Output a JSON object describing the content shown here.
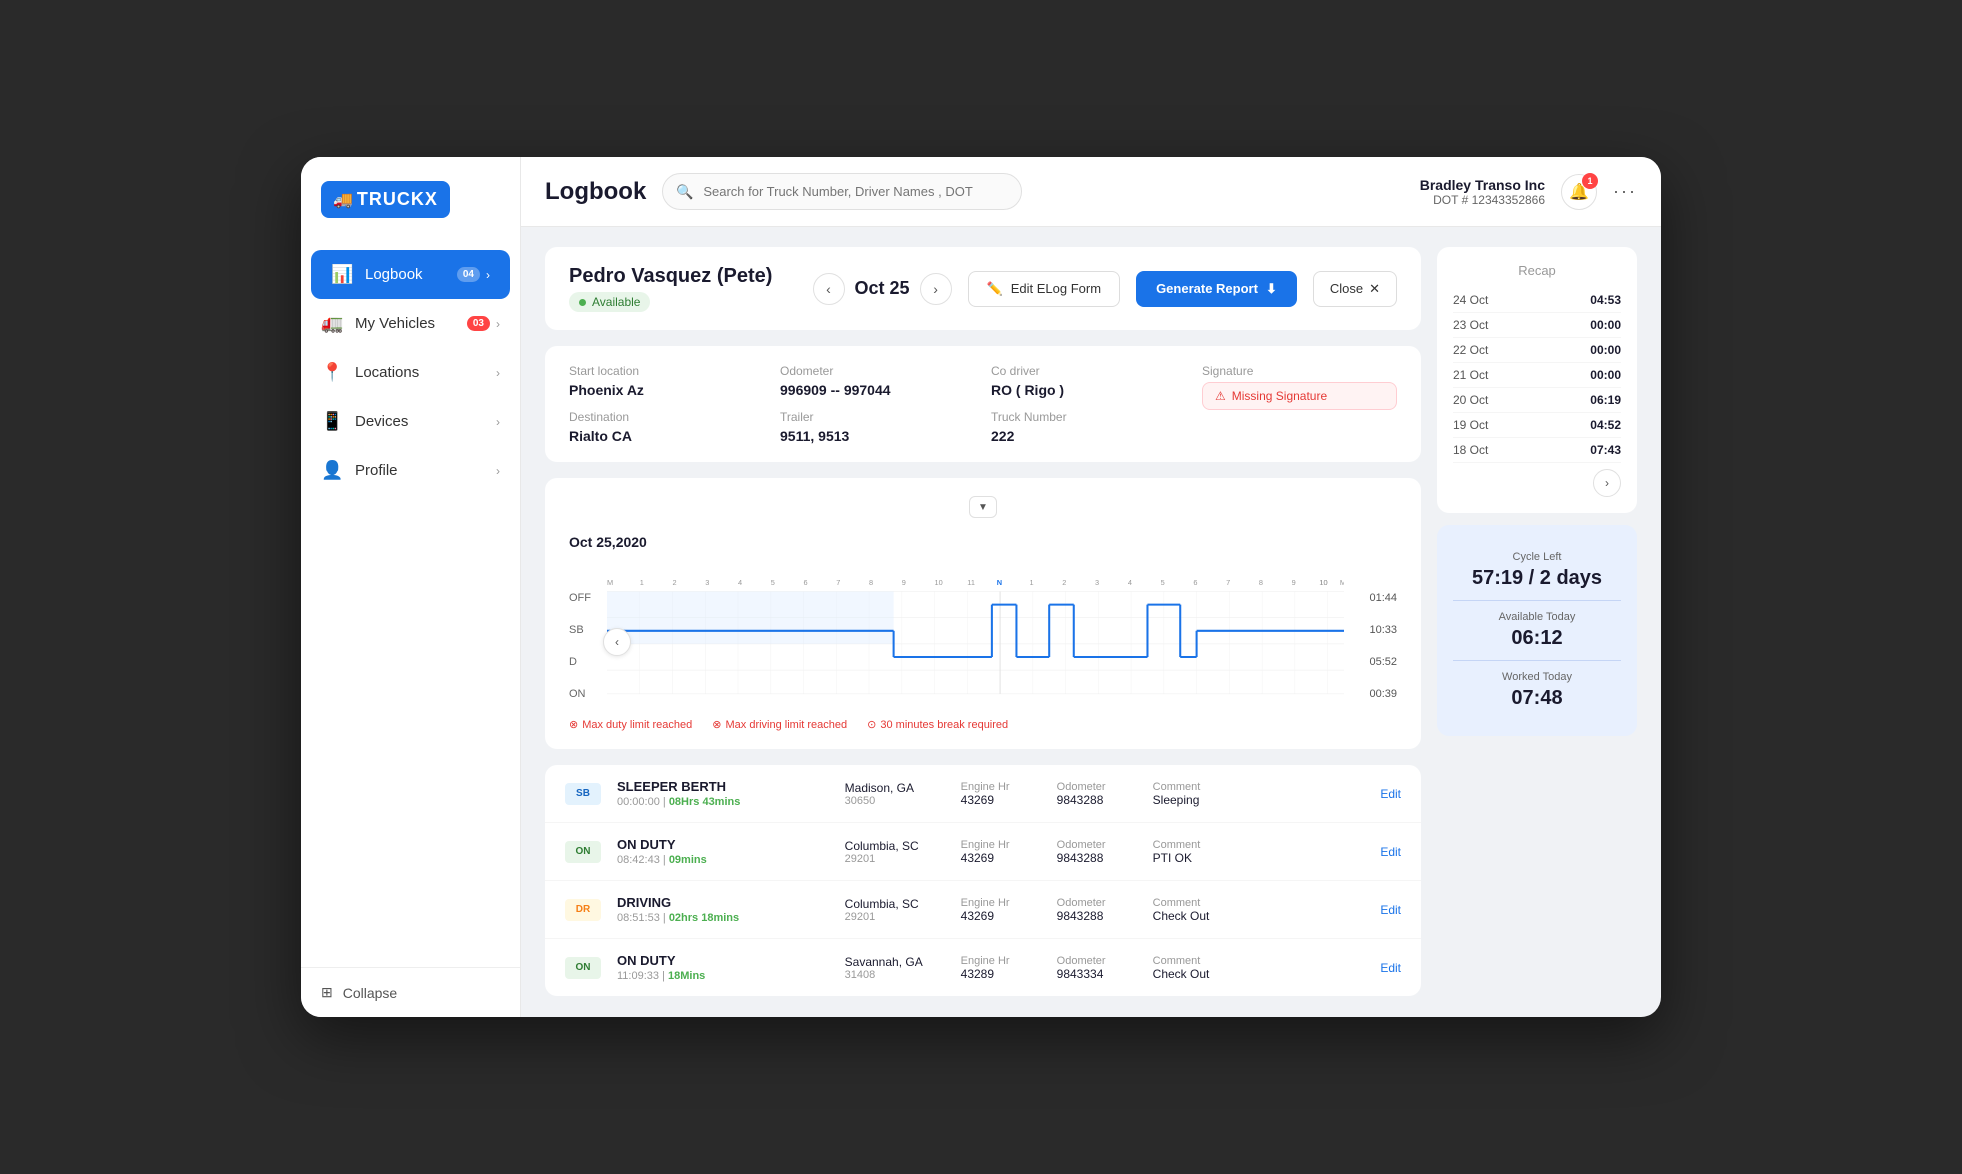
{
  "app": {
    "title": "Logbook"
  },
  "header": {
    "title": "Logbook",
    "search_placeholder": "Search for Truck Number, Driver Names , DOT",
    "company_name": "Bradley Transo Inc",
    "company_dot": "DOT # 12343352866",
    "notification_count": "1"
  },
  "sidebar": {
    "logo_text": "TRUCKX",
    "items": [
      {
        "id": "logbook",
        "label": "Logbook",
        "icon": "📊",
        "active": true,
        "badge": "04"
      },
      {
        "id": "my-vehicles",
        "label": "My Vehicles",
        "icon": "🚛",
        "active": false,
        "badge": "03"
      },
      {
        "id": "locations",
        "label": "Locations",
        "icon": "📍",
        "active": false
      },
      {
        "id": "devices",
        "label": "Devices",
        "icon": "📱",
        "active": false
      },
      {
        "id": "profile",
        "label": "Profile",
        "icon": "👤",
        "active": false
      }
    ],
    "collapse_label": "Collapse"
  },
  "driver": {
    "name": "Pedro Vasquez (Pete)",
    "status": "Available",
    "date": "Oct 25"
  },
  "trip": {
    "start_location_label": "Start location",
    "start_location": "Phoenix Az",
    "destination_label": "Destination",
    "destination": "Rialto CA",
    "odometer_label": "Odometer",
    "odometer": "996909 -- 997044",
    "trailer_label": "Trailer",
    "trailer": "9511, 9513",
    "co_driver_label": "Co driver",
    "co_driver": "RO ( Rigo )",
    "truck_number_label": "Truck Number",
    "truck_number": "222",
    "signature_label": "Signature",
    "missing_signature": "Missing Signature"
  },
  "chart": {
    "date_label": "Oct 25,2020",
    "rows": [
      "OFF",
      "SB",
      "D",
      "ON"
    ],
    "times": [
      "01:44",
      "10:33",
      "05:52",
      "00:39"
    ],
    "warnings": [
      "Max duty limit reached",
      "Max driving limit reached",
      "30 minutes break required"
    ]
  },
  "entries": [
    {
      "type": "SB",
      "type_color": "sb",
      "name": "SLEEPER BERTH",
      "start_time": "00:00:00",
      "duration": "08Hrs 43mins",
      "location": "Madison, GA",
      "location_code": "30650",
      "engine_hr_label": "Engine Hr",
      "engine_hr": "43269",
      "odometer_label": "Odometer",
      "odometer": "9843288",
      "comment_label": "Comment",
      "comment": "Sleeping",
      "edit_label": "Edit"
    },
    {
      "type": "ON",
      "type_color": "on",
      "name": "ON DUTY",
      "start_time": "08:42:43",
      "duration": "09mins",
      "location": "Columbia, SC",
      "location_code": "29201",
      "engine_hr_label": "Engine Hr",
      "engine_hr": "43269",
      "odometer_label": "Odometer",
      "odometer": "9843288",
      "comment_label": "Comment",
      "comment": "PTI OK",
      "edit_label": "Edit"
    },
    {
      "type": "DR",
      "type_color": "dr",
      "name": "DRIVING",
      "start_time": "08:51:53",
      "duration": "02hrs 18mins",
      "location": "Columbia, SC",
      "location_code": "29201",
      "engine_hr_label": "Engine Hr",
      "engine_hr": "43269",
      "odometer_label": "Odometer",
      "odometer": "9843288",
      "comment_label": "Comment",
      "comment": "Check Out",
      "edit_label": "Edit"
    },
    {
      "type": "ON",
      "type_color": "on",
      "name": "ON DUTY",
      "start_time": "11:09:33",
      "duration": "18Mins",
      "location": "Savannah, GA",
      "location_code": "31408",
      "engine_hr_label": "Engine Hr",
      "engine_hr": "43289",
      "odometer_label": "Odometer",
      "odometer": "9843334",
      "comment_label": "Comment",
      "comment": "Check Out",
      "edit_label": "Edit"
    }
  ],
  "recap": {
    "title": "Recap",
    "items": [
      {
        "date": "24 Oct",
        "time": "04:53"
      },
      {
        "date": "23 Oct",
        "time": "00:00"
      },
      {
        "date": "22 Oct",
        "time": "00:00"
      },
      {
        "date": "21 Oct",
        "time": "00:00"
      },
      {
        "date": "20 Oct",
        "time": "06:19"
      },
      {
        "date": "19 Oct",
        "time": "04:52"
      },
      {
        "date": "18 Oct",
        "time": "07:43"
      }
    ]
  },
  "cycle": {
    "cycle_left_label": "Cycle Left",
    "cycle_left_value": "57:19 / 2 days",
    "available_today_label": "Available Today",
    "available_today_value": "06:12",
    "worked_today_label": "Worked Today",
    "worked_today_value": "07:48"
  },
  "buttons": {
    "edit_elog": "Edit ELog Form",
    "generate_report": "Generate Report",
    "close": "Close"
  }
}
